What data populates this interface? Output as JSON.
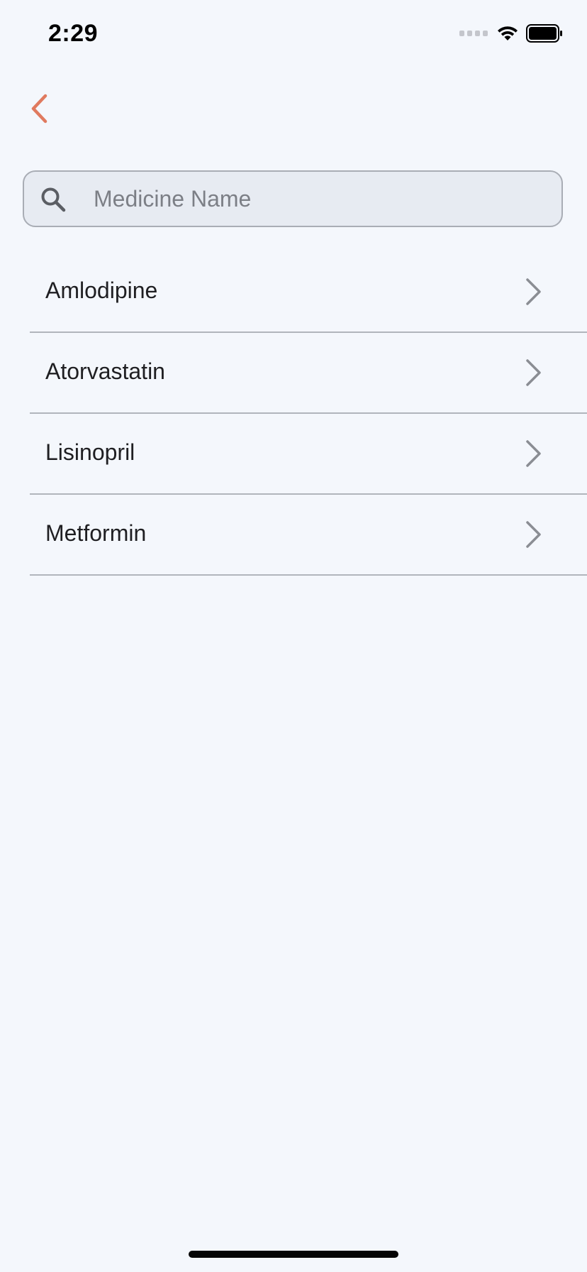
{
  "status_bar": {
    "time": "2:29"
  },
  "nav": {
    "back_icon": "chevron-left-icon",
    "accent_color": "#e07a5f"
  },
  "search": {
    "placeholder": "Medicine Name",
    "value": "",
    "icon": "search-icon"
  },
  "medicines": [
    {
      "name": "Amlodipine"
    },
    {
      "name": "Atorvastatin"
    },
    {
      "name": "Lisinopril"
    },
    {
      "name": "Metformin"
    }
  ],
  "colors": {
    "background": "#f4f7fc",
    "divider": "#b1b5bc",
    "chevron": "#8a8d93"
  }
}
